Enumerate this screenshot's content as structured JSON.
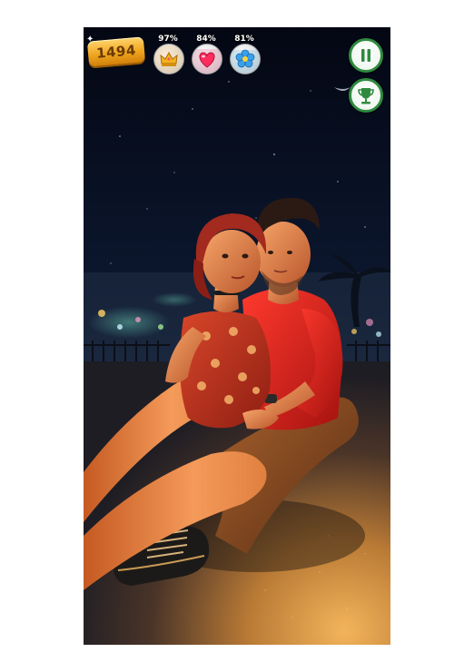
{
  "hud": {
    "coins": "1494",
    "stats": [
      {
        "id": "crown",
        "value_label": "97%",
        "percent": 97,
        "icon": "crown-icon",
        "color": "#e8931b"
      },
      {
        "id": "love",
        "value_label": "84%",
        "percent": 84,
        "icon": "heart-icon",
        "color": "#e5306a"
      },
      {
        "id": "mood",
        "value_label": "81%",
        "percent": 81,
        "icon": "flower-icon",
        "color": "#2a9ad8"
      }
    ],
    "buttons": {
      "pause_icon": "pause-icon",
      "trophy_icon": "trophy-icon"
    },
    "accent": "#2f8a3e"
  }
}
